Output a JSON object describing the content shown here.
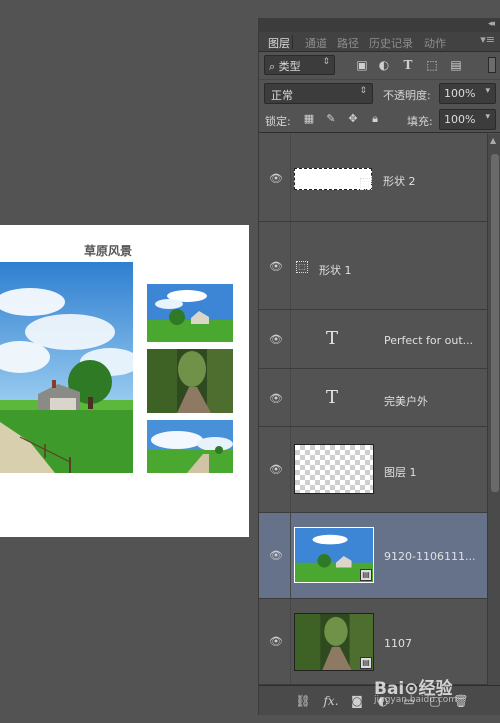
{
  "canvas": {
    "title": "草原风景"
  },
  "panel": {
    "tabs": [
      {
        "label": "图层",
        "active": true
      },
      {
        "label": "通道",
        "active": false
      },
      {
        "label": "路径",
        "active": false
      },
      {
        "label": "历史记录",
        "active": false
      },
      {
        "label": "动作",
        "active": false
      }
    ],
    "filter": {
      "icon": "search-icon",
      "label": "类型",
      "icons": [
        "image-filter-icon",
        "adjustment-filter-icon",
        "type-filter-icon",
        "shape-filter-icon",
        "smart-object-filter-icon"
      ]
    },
    "blend_mode": "正常",
    "opacity_label": "不透明度:",
    "opacity_value": "100%",
    "lock_label": "锁定:",
    "lock_icons": [
      "lock-transparent-icon",
      "lock-paint-icon",
      "lock-position-icon",
      "lock-all-icon"
    ],
    "fill_label": "填充:",
    "fill_value": "100%"
  },
  "layers": [
    {
      "name": "形状 2",
      "kind": "shape",
      "selected": false
    },
    {
      "name": "形状 1",
      "kind": "shape-path",
      "selected": false
    },
    {
      "name": "Perfect for out...",
      "kind": "text",
      "selected": false
    },
    {
      "name": "完美户外",
      "kind": "text",
      "selected": false
    },
    {
      "name": "图层 1",
      "kind": "pixel-empty",
      "selected": false
    },
    {
      "name": "9120-1106111...",
      "kind": "smart-object",
      "selected": true
    },
    {
      "name": "1107",
      "kind": "smart-object",
      "selected": false
    }
  ],
  "bottom_toolbar": {
    "fx": "fx.",
    "icons": [
      "link-icon",
      "fx-icon",
      "mask-icon",
      "adjustment-icon",
      "group-icon",
      "new-layer-icon",
      "trash-icon"
    ]
  },
  "watermark": {
    "logo": "Bai⊙经验",
    "url": "jingyan.baidu.com"
  },
  "colors": {
    "workspace": "#535353",
    "selected_layer": "#66728a",
    "canvas": "#ffffff"
  }
}
